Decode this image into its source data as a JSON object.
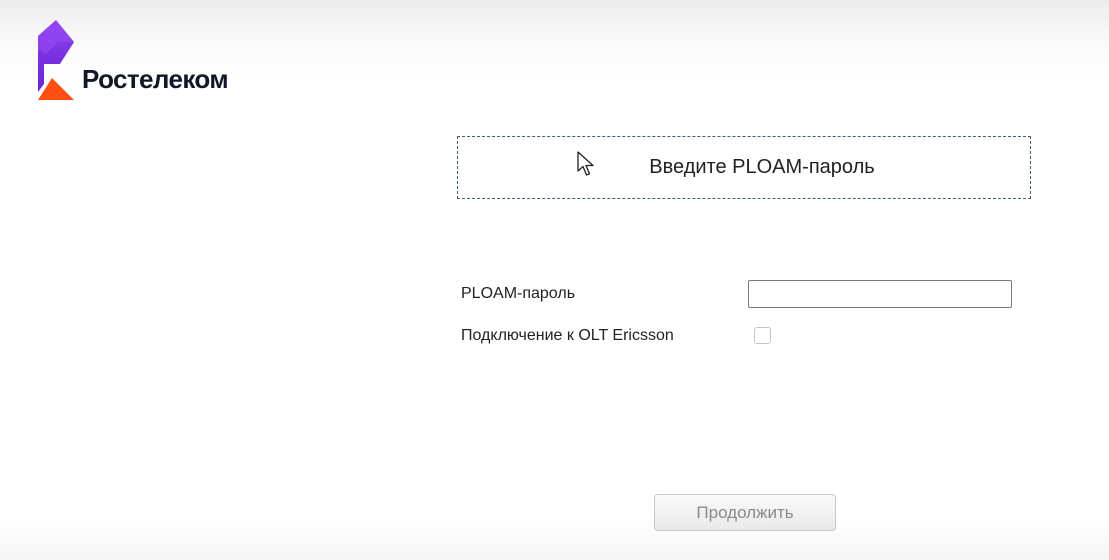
{
  "brand": {
    "name": "Ростелеком",
    "logo_icon": "rostelecom-logo-icon",
    "colors": {
      "purple": "#7b2fe0",
      "orange": "#ff4f12",
      "text": "#101828"
    }
  },
  "heading": {
    "title": "Введите PLOAM-пароль",
    "cursor_icon": "mouse-pointer-icon"
  },
  "form": {
    "password_label": "PLOAM-пароль",
    "password_value": "",
    "olt_label": "Подключение к OLT Ericsson",
    "olt_checked": false
  },
  "actions": {
    "continue_label": "Продолжить"
  }
}
